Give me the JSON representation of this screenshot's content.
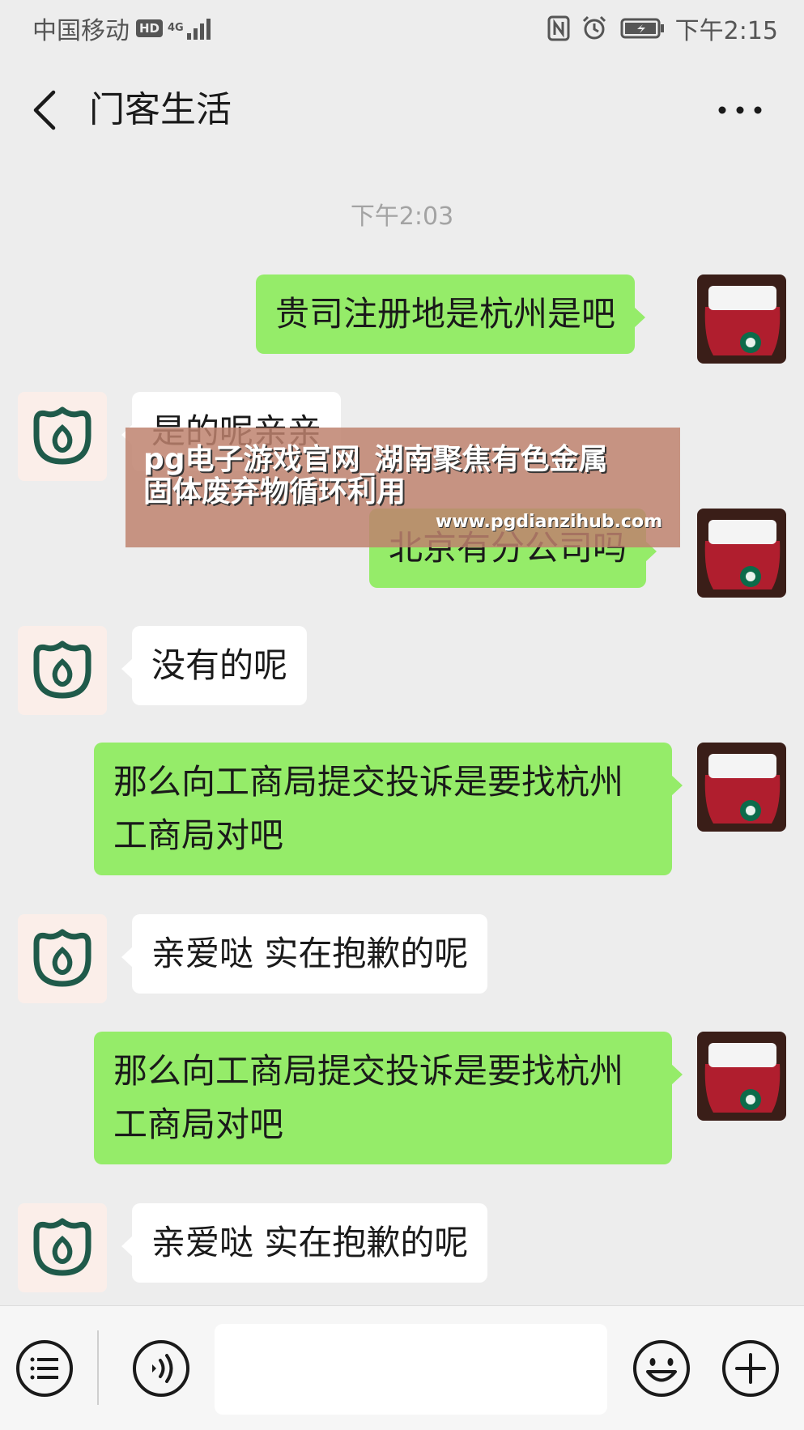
{
  "status_bar": {
    "carrier": "中国移动",
    "hd": "HD",
    "network": "4G",
    "time": "下午2:15"
  },
  "nav": {
    "title": "门客生活",
    "back_icon": "chevron-left-icon",
    "more_icon": "ellipsis-icon"
  },
  "chat": {
    "timestamp": "下午2:03",
    "messages": [
      {
        "sender": "me",
        "text": "贵司注册地是杭州是吧"
      },
      {
        "sender": "shop",
        "text": "是的呢亲亲"
      },
      {
        "sender": "me",
        "text": "北京有分公司吗"
      },
      {
        "sender": "shop",
        "text": "没有的呢"
      },
      {
        "sender": "me",
        "text": "那么向工商局提交投诉是要找杭州工商局对吧"
      },
      {
        "sender": "shop",
        "text": "亲爱哒 实在抱歉的呢"
      },
      {
        "sender": "me",
        "text": "那么向工商局提交投诉是要找杭州工商局对吧"
      },
      {
        "sender": "shop",
        "text": "亲爱哒 实在抱歉的呢"
      }
    ]
  },
  "watermark": {
    "title": "pg电子游戏官网_湖南聚焦有色金属固体废弃物循环利用",
    "url": "www.pgdianzihub.com"
  },
  "input_bar": {
    "text_value": "",
    "icons": [
      "menu-icon",
      "voice-icon",
      "emoji-icon",
      "plus-icon"
    ]
  },
  "colors": {
    "my_bubble": "#95ec69",
    "their_bubble": "#ffffff",
    "background": "#ededed",
    "shop_logo": "#1f5a4a"
  }
}
